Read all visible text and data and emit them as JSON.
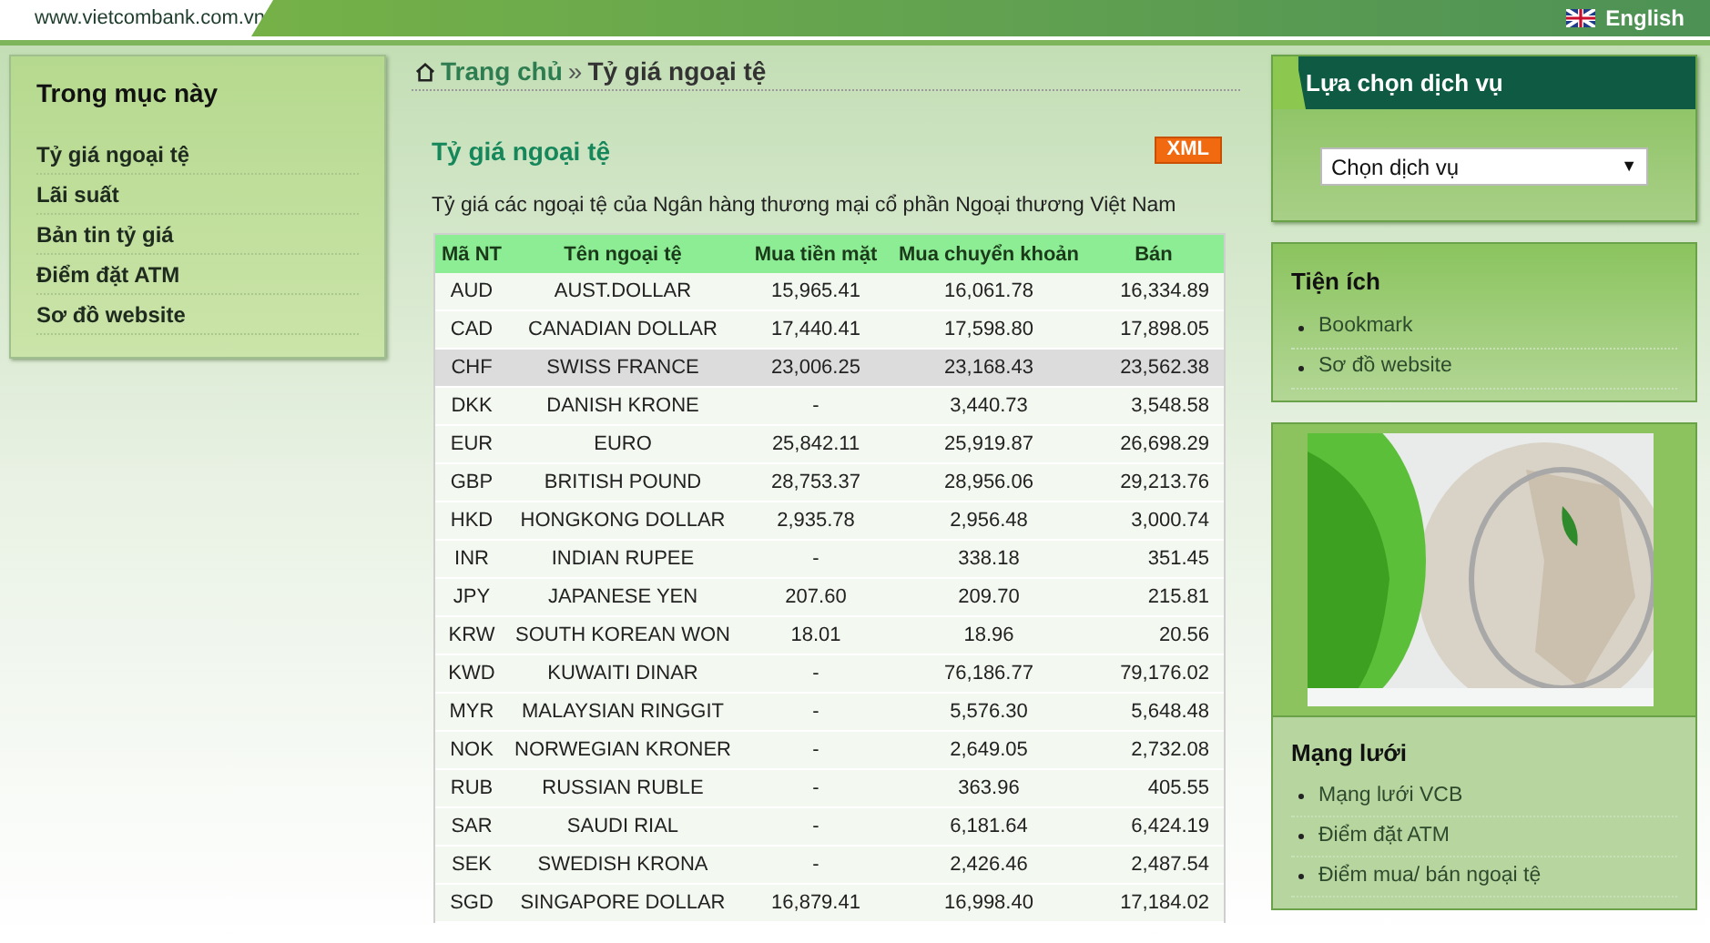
{
  "header": {
    "site": "www.vietcombank.com.vn",
    "language": "English"
  },
  "sidebar": {
    "title": "Trong mục này",
    "items": [
      "Tỷ giá ngoại tệ",
      "Lãi suất",
      "Bản tin tỷ giá",
      "Điểm đặt ATM",
      "Sơ đồ website"
    ]
  },
  "breadcrumb": {
    "home": "Trang chủ",
    "separator": "»",
    "current": "Tỷ giá ngoại tệ"
  },
  "page": {
    "title": "Tỷ giá ngoại tệ",
    "xml_badge": "XML",
    "description": "Tỷ giá các ngoại tệ của Ngân hàng thương mại cổ phần Ngoại thương Việt Nam"
  },
  "table": {
    "columns": [
      "Mã NT",
      "Tên ngoại tệ",
      "Mua tiền mặt",
      "Mua chuyển khoản",
      "Bán"
    ],
    "rows": [
      {
        "cells": [
          "AUD",
          "AUST.DOLLAR",
          "15,965.41",
          "16,061.78",
          "16,334.89"
        ],
        "selected": false
      },
      {
        "cells": [
          "CAD",
          "CANADIAN DOLLAR",
          "17,440.41",
          "17,598.80",
          "17,898.05"
        ],
        "selected": false
      },
      {
        "cells": [
          "CHF",
          "SWISS FRANCE",
          "23,006.25",
          "23,168.43",
          "23,562.38"
        ],
        "selected": true
      },
      {
        "cells": [
          "DKK",
          "DANISH KRONE",
          "-",
          "3,440.73",
          "3,548.58"
        ],
        "selected": false
      },
      {
        "cells": [
          "EUR",
          "EURO",
          "25,842.11",
          "25,919.87",
          "26,698.29"
        ],
        "selected": false
      },
      {
        "cells": [
          "GBP",
          "BRITISH POUND",
          "28,753.37",
          "28,956.06",
          "29,213.76"
        ],
        "selected": false
      },
      {
        "cells": [
          "HKD",
          "HONGKONG DOLLAR",
          "2,935.78",
          "2,956.48",
          "3,000.74"
        ],
        "selected": false
      },
      {
        "cells": [
          "INR",
          "INDIAN RUPEE",
          "-",
          "338.18",
          "351.45"
        ],
        "selected": false
      },
      {
        "cells": [
          "JPY",
          "JAPANESE YEN",
          "207.60",
          "209.70",
          "215.81"
        ],
        "selected": false
      },
      {
        "cells": [
          "KRW",
          "SOUTH KOREAN WON",
          "18.01",
          "18.96",
          "20.56"
        ],
        "selected": false
      },
      {
        "cells": [
          "KWD",
          "KUWAITI DINAR",
          "-",
          "76,186.77",
          "79,176.02"
        ],
        "selected": false
      },
      {
        "cells": [
          "MYR",
          "MALAYSIAN RINGGIT",
          "-",
          "5,576.30",
          "5,648.48"
        ],
        "selected": false
      },
      {
        "cells": [
          "NOK",
          "NORWEGIAN KRONER",
          "-",
          "2,649.05",
          "2,732.08"
        ],
        "selected": false
      },
      {
        "cells": [
          "RUB",
          "RUSSIAN RUBLE",
          "-",
          "363.96",
          "405.55"
        ],
        "selected": false
      },
      {
        "cells": [
          "SAR",
          "SAUDI RIAL",
          "-",
          "6,181.64",
          "6,424.19"
        ],
        "selected": false
      },
      {
        "cells": [
          "SEK",
          "SWEDISH KRONA",
          "-",
          "2,426.46",
          "2,487.54"
        ],
        "selected": false
      },
      {
        "cells": [
          "SGD",
          "SINGAPORE DOLLAR",
          "16,879.41",
          "16,998.40",
          "17,184.02"
        ],
        "selected": false
      }
    ]
  },
  "services": {
    "title": "Lựa chọn dịch vụ",
    "select_value": "Chọn dịch vụ",
    "caret": "▼"
  },
  "utilities": {
    "title": "Tiện ích",
    "items": [
      "Bookmark",
      "Sơ đồ website"
    ]
  },
  "network": {
    "title": "Mạng lưới",
    "items": [
      "Mạng lưới VCB",
      "Điểm đặt ATM",
      "Điểm mua/ bán ngoại tệ"
    ]
  }
}
